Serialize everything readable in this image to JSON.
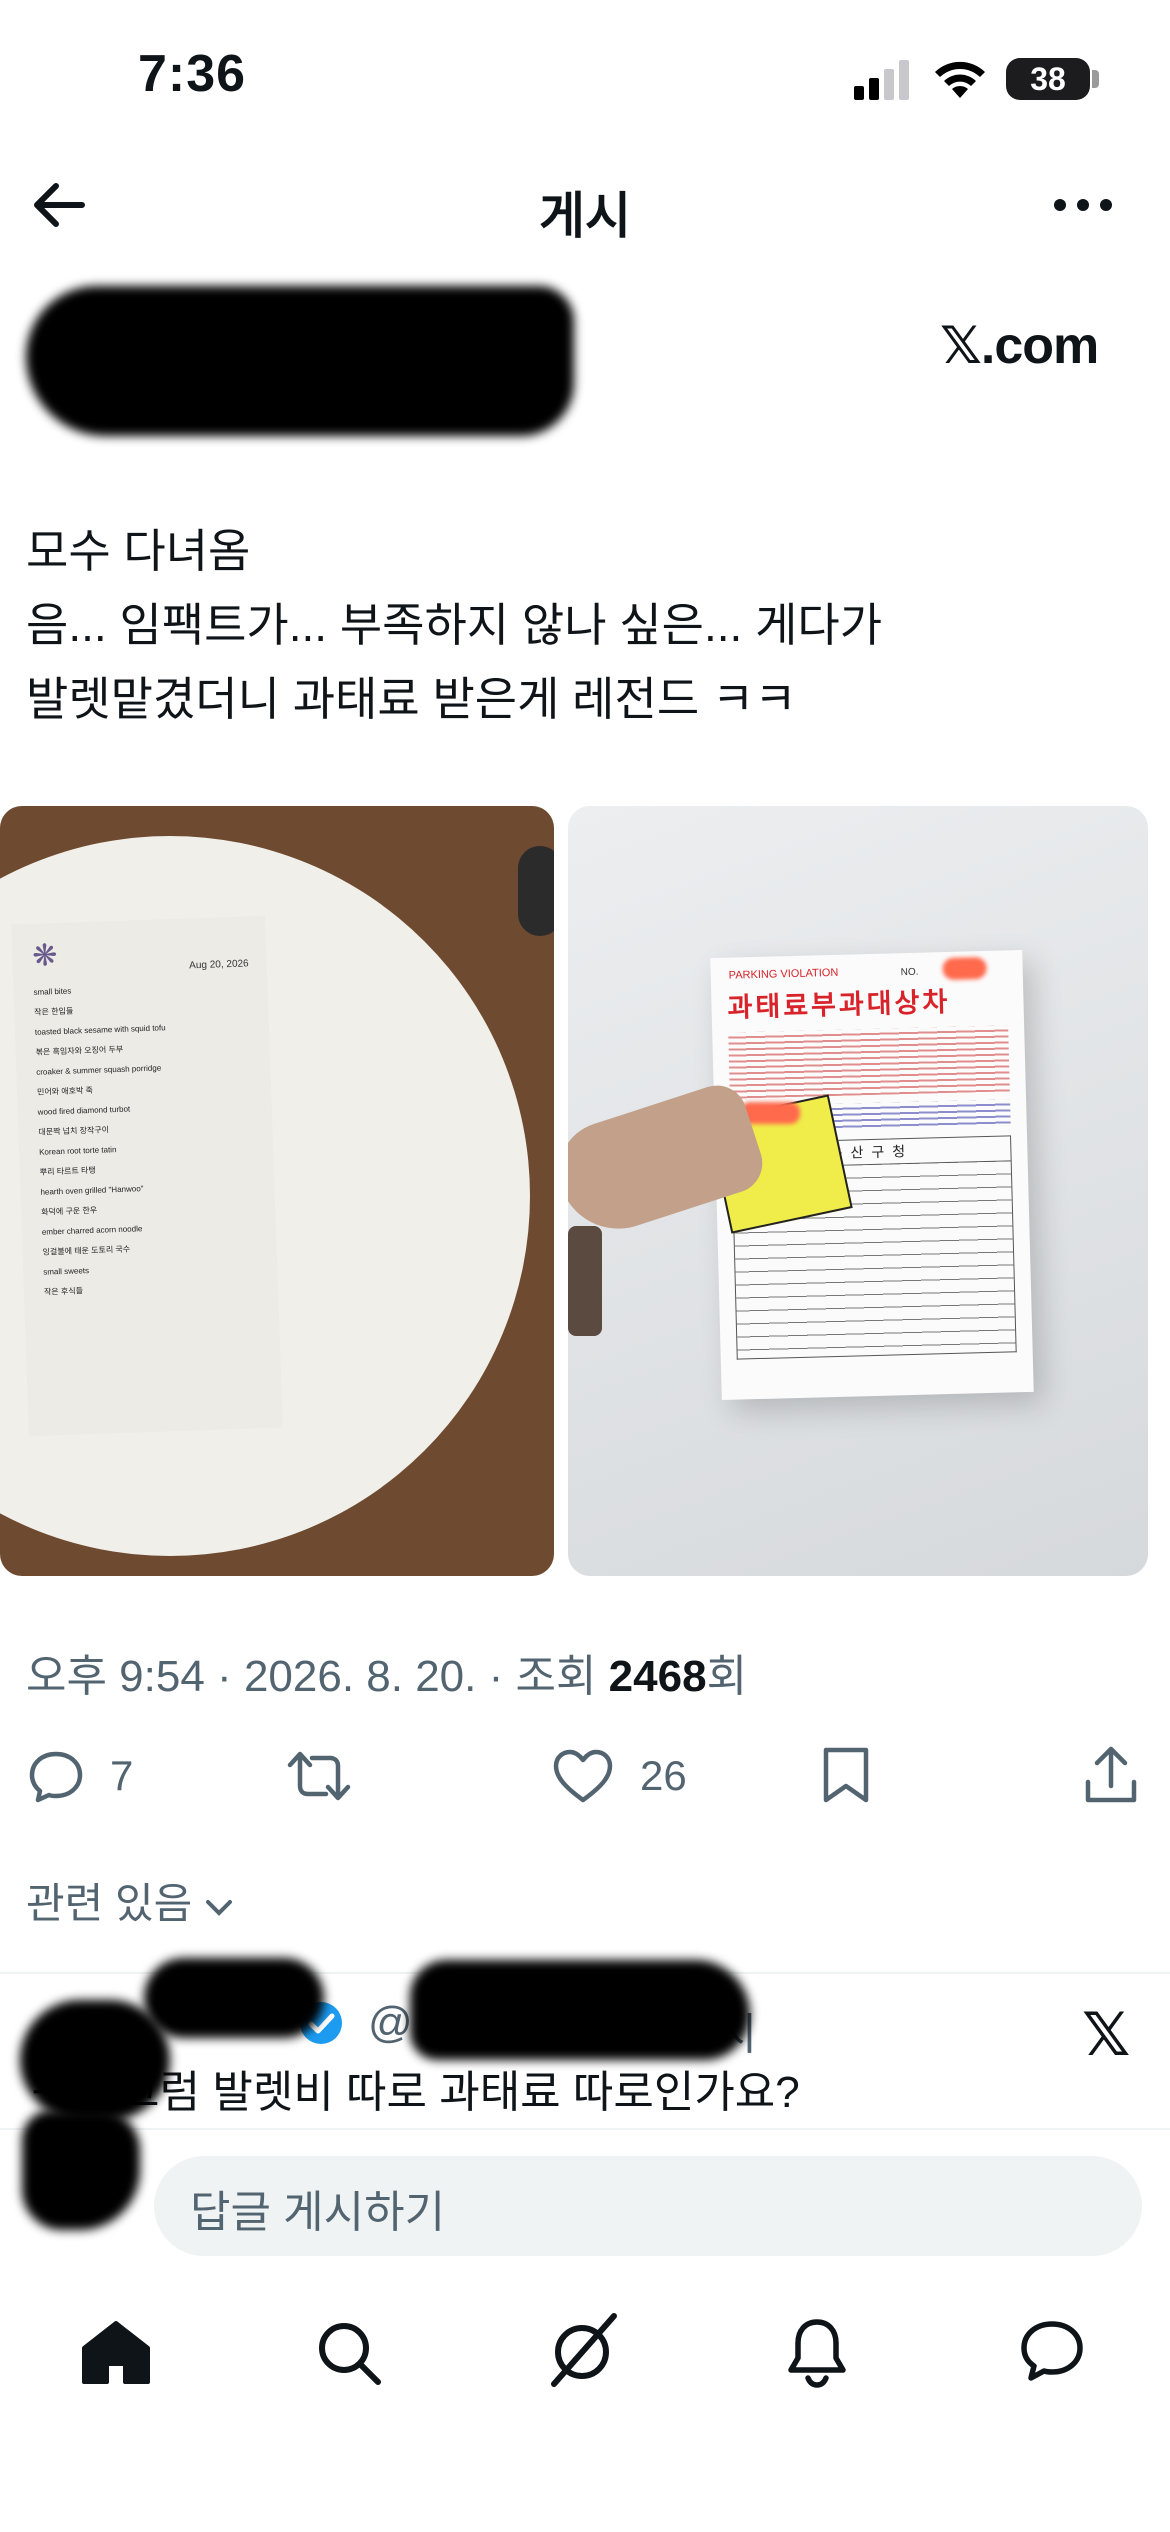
{
  "status_bar": {
    "time": "7:36",
    "battery": "38"
  },
  "header": {
    "title": "게시"
  },
  "post": {
    "source": "𝕏.com",
    "lines": [
      "모수 다녀옴",
      "음... 임팩트가... 부족하지 않나 싶은... 게다가",
      "발렛맡겼더니 과태료 받은게 레전드 ㅋㅋ"
    ],
    "menu": {
      "date": "Aug 20, 2026",
      "items": [
        "small bites",
        "작은 한입들",
        "toasted black sesame with squid tofu",
        "볶은 흑임자와 오징어 두부",
        "croaker & summer squash porridge",
        "민어와 애호박 죽",
        "wood fired diamond turbot",
        "대문짝 넙치 장작구이",
        "Korean root torte tatin",
        "뿌리 타르트 타탱",
        "hearth oven grilled \"Hanwoo\"",
        "화덕에 구운 한우",
        "ember charred acorn noodle",
        "잉걸불에 태운 도토리 국수",
        "small sweets",
        "작은 후식들"
      ]
    },
    "ticket": {
      "header_en": "PARKING VIOLATION",
      "no_label": "NO.",
      "title_ko": "과태료부과대상차",
      "office": "용산구청"
    },
    "meta": {
      "time": "오후 9:54",
      "date": "2026. 8. 20.",
      "views_label": "조회",
      "views": "2468",
      "views_suffix": "회"
    },
    "actions": {
      "replies": "7",
      "likes": "26"
    }
  },
  "related": {
    "label": "관련 있음"
  },
  "reply_preview": {
    "handle": "@",
    "time": "8시",
    "text": "ㅋㅋ 그럼 발렛비 따로 과태료 따로인가요?"
  },
  "reply_input": {
    "placeholder": "답글 게시하기"
  },
  "colors": {
    "accent": "#1d9bf0",
    "text": "#0f1419",
    "muted": "#536471",
    "ticket_red": "#d8232a"
  }
}
